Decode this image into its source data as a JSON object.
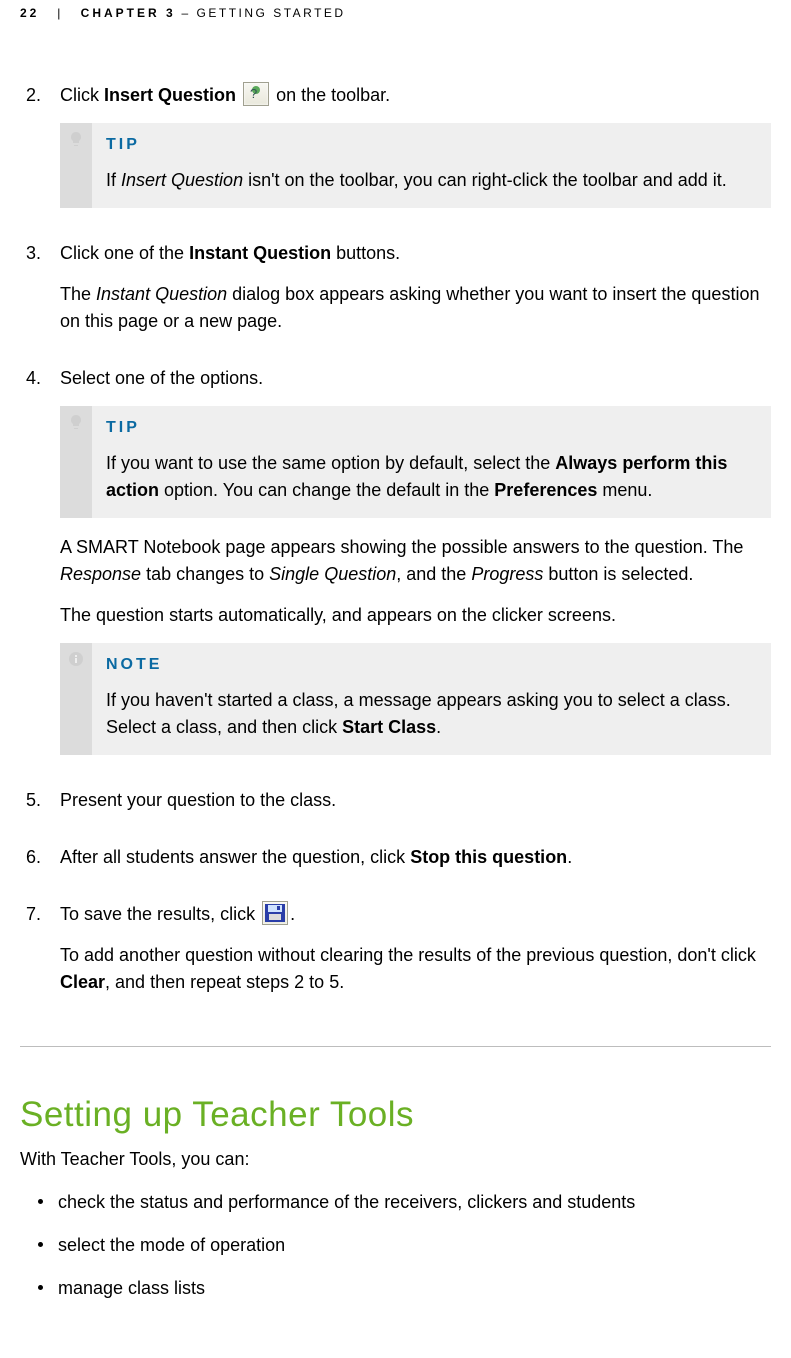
{
  "header": {
    "page": "22",
    "chapter": "CHAPTER 3",
    "title": "– GETTING STARTED"
  },
  "steps": {
    "s2": {
      "num": "2.",
      "pre": "Click ",
      "bold": "Insert Question",
      "post": " on the toolbar.",
      "tip_kind": "TIP",
      "tip_pre": "If ",
      "tip_ital": "Insert Question",
      "tip_post": " isn't on the toolbar, you can right-click the toolbar and add it."
    },
    "s3": {
      "num": "3.",
      "p1a": "Click one of the ",
      "p1b": "Instant Question",
      "p1c": " buttons.",
      "p2a": "The ",
      "p2b": "Instant Question",
      "p2c": " dialog box appears asking whether you want to insert the question on this page or a new page."
    },
    "s4": {
      "num": "4.",
      "p1": "Select one of the options.",
      "tip_kind": "TIP",
      "tip_a": "If you want to use the same option by default, select the ",
      "tip_b": "Always perform this action",
      "tip_c": " option. You can change the default in the ",
      "tip_d": "Preferences",
      "tip_e": " menu.",
      "p2a": "A SMART Notebook page appears showing the possible answers to the question. The ",
      "p2b": "Response",
      "p2c": " tab changes to ",
      "p2d": "Single Question",
      "p2e": ", and the ",
      "p2f": "Progress",
      "p2g": " button is selected.",
      "p3": "The question starts automatically, and appears on the clicker screens.",
      "note_kind": "NOTE",
      "note_a": "If you haven't started a class, a message appears asking you to select a class. Select a class, and then click ",
      "note_b": "Start Class",
      "note_c": "."
    },
    "s5": {
      "num": "5.",
      "p1": "Present your question to the class."
    },
    "s6": {
      "num": "6.",
      "p1a": "After all students answer the question, click ",
      "p1b": "Stop this question",
      "p1c": "."
    },
    "s7": {
      "num": "7.",
      "p1a": "To save the results, click ",
      "p1b": ".",
      "p2a": "To add another question without clearing the results of the previous question, don't click ",
      "p2b": "Clear",
      "p2c": ", and then repeat steps 2 to 5."
    }
  },
  "section": {
    "heading": "Setting up Teacher Tools",
    "intro": "With Teacher Tools, you can:",
    "bullets": [
      "check the status and performance of the receivers, clickers and students",
      "select the mode of operation",
      "manage class lists"
    ]
  }
}
